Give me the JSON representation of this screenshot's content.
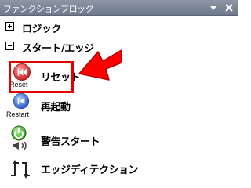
{
  "panel": {
    "title": "ファンクションブロック",
    "menu_icon": "dropdown-triangle-icon",
    "close_icon": "close-icon"
  },
  "tree": [
    {
      "label": "ロジック",
      "expander": "plus"
    },
    {
      "label": "スタート/エッジ",
      "expander": "minus"
    }
  ],
  "items": [
    {
      "label": "リセット",
      "sub": "Reset",
      "icon": "reset-icon"
    },
    {
      "label": "再起動",
      "sub": "Restart",
      "icon": "restart-icon"
    },
    {
      "label": "警告スタート",
      "sub": "",
      "icon": "warning-start-icon"
    },
    {
      "label": "エッジディテクション",
      "sub": "",
      "icon": "edge-detection-icon"
    }
  ],
  "colors": {
    "highlight": "#e00000",
    "header": "#7a8597"
  }
}
